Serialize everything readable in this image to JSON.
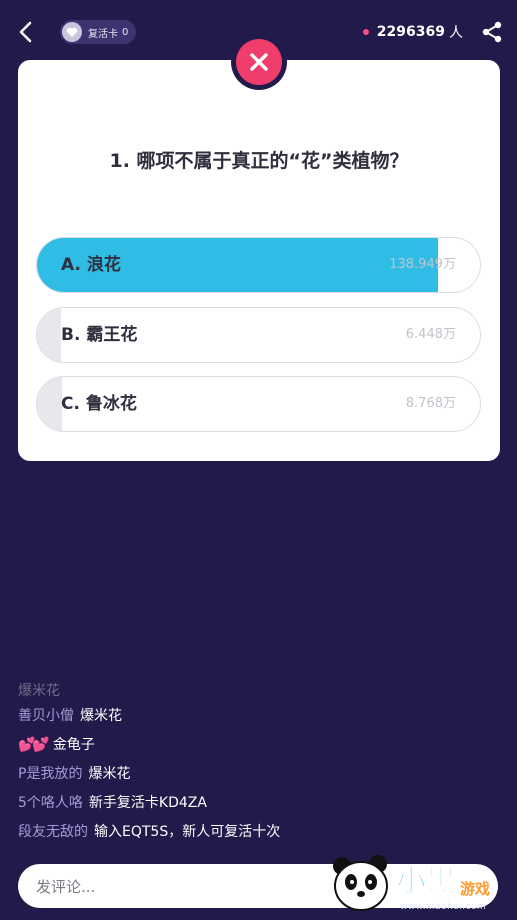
{
  "header": {
    "revive_label": "复活卡",
    "revive_count": "0",
    "online_count": "2296369",
    "online_unit": "人"
  },
  "question": "1. 哪项不属于真正的“花”类植物？",
  "options": [
    {
      "label": "A. 浪花",
      "votes": "138.949万",
      "share": 0.906,
      "correct": true
    },
    {
      "label": "B. 霸王花",
      "votes": "6.448万",
      "share": 0.042,
      "correct": false
    },
    {
      "label": "C. 鲁冰花",
      "votes": "8.768万",
      "share": 0.056,
      "correct": false
    }
  ],
  "comments": [
    {
      "user": "善贝小僧",
      "msg": "爆米花"
    },
    {
      "user": "💕💕",
      "msg": "金龟子"
    },
    {
      "user": "P是我放的",
      "msg": "爆米花"
    },
    {
      "user": "5个咯人咯",
      "msg": "新手复活卡KD4ZA"
    },
    {
      "user": "段友无敌的",
      "msg": "输入EQT5S，新人可复活十次"
    }
  ],
  "faded_comment": {
    "msg": "爆米花"
  },
  "comment_input": {
    "placeholder": "发评论..."
  },
  "watermark": {
    "logo": "小黑",
    "logo2": "游戏",
    "url": "www.xiaohei.com"
  },
  "colors": {
    "background": "#221a4a",
    "accent": "#2fbde6",
    "wrong": "#ef3e6c"
  }
}
